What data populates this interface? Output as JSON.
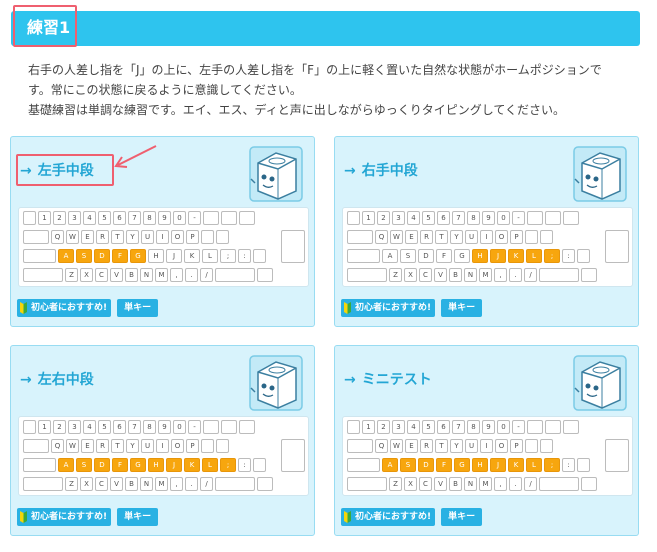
{
  "header": {
    "title": "練習1"
  },
  "intro": {
    "line1": "右手の人差し指を「J」の上に、左手の人差し指を「F」の上に軽く置いた自然な状態がホームポジションで",
    "line2": "す。常にこの状態に戻るように意識してください。",
    "line3": "基礎練習は単調な練習です。エイ、エス、ディと声に出しながらゆっくりタイピングしてください。"
  },
  "icons": {
    "arrow": "→"
  },
  "keyboard": {
    "row1": [
      "",
      "1",
      "2",
      "3",
      "4",
      "5",
      "6",
      "7",
      "8",
      "9",
      "0",
      "-",
      "",
      "",
      ""
    ],
    "row2": [
      "",
      "Q",
      "W",
      "E",
      "R",
      "T",
      "Y",
      "U",
      "I",
      "O",
      "P",
      "",
      ""
    ],
    "row3": [
      "",
      "A",
      "S",
      "D",
      "F",
      "G",
      "H",
      "J",
      "K",
      "L",
      ";",
      ":",
      ""
    ],
    "row4": [
      "",
      "Z",
      "X",
      "C",
      "V",
      "B",
      "N",
      "M",
      ",",
      ".",
      "/",
      "",
      ""
    ]
  },
  "cards": [
    {
      "title": "左手中段",
      "highlight": [
        "A",
        "S",
        "D",
        "F",
        "G"
      ],
      "tag_beginner": "初心者におすすめ!",
      "tag_single": "単キー"
    },
    {
      "title": "右手中段",
      "highlight": [
        "H",
        "J",
        "K",
        "L",
        ";"
      ],
      "tag_beginner": "初心者におすすめ!",
      "tag_single": "単キー"
    },
    {
      "title": "左右中段",
      "highlight": [
        "A",
        "S",
        "D",
        "F",
        "G",
        "H",
        "J",
        "K",
        "L",
        ";"
      ],
      "tag_beginner": "初心者におすすめ!",
      "tag_single": "単キー"
    },
    {
      "title": "ミニテスト",
      "highlight": [
        "A",
        "S",
        "D",
        "F",
        "G",
        "H",
        "J",
        "K",
        "L",
        ";"
      ],
      "tag_beginner": "初心者におすすめ!",
      "tag_single": "単キー"
    }
  ],
  "colors": {
    "accent": "#2ec4ee",
    "highlight": "#f7a60e",
    "annotation": "#ef5f6f"
  }
}
